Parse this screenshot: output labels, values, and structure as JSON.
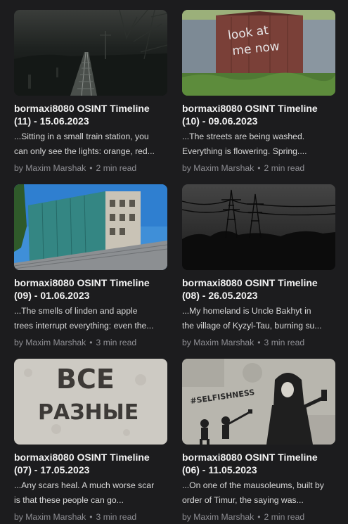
{
  "cards": [
    {
      "title_line1": "bormaxi8080 OSINT Timeline",
      "title_line2": "(11) - 15.06.2023",
      "excerpt_line1": "...Sitting in a small train station, you",
      "excerpt_line2": "can only see the lights: orange, red...",
      "author": "by Maxim Marshak",
      "read_time": "2 min read",
      "image": "railway-night-photo"
    },
    {
      "title_line1": "bormaxi8080 OSINT Timeline",
      "title_line2": "(10) - 09.06.2023",
      "excerpt_line1": "...The streets are being washed.",
      "excerpt_line2": "Everything is flowering. Spring....",
      "author": "by Maxim Marshak",
      "read_time": "2 min read",
      "image": "garage-graffiti-photo",
      "graffiti_line1": "look at",
      "graffiti_line2": "me now"
    },
    {
      "title_line1": "bormaxi8080 OSINT Timeline",
      "title_line2": "(09) - 01.06.2023",
      "excerpt_line1": "...The smells of linden and apple",
      "excerpt_line2": "trees interrupt everything: even the...",
      "author": "by Maxim Marshak",
      "read_time": "3 min read",
      "image": "covered-building-photo"
    },
    {
      "title_line1": "bormaxi8080 OSINT Timeline",
      "title_line2": "(08) - 26.05.2023",
      "excerpt_line1": "...My homeland is Uncle Bakhyt in",
      "excerpt_line2": "the village of Kyzyl-Tau, burning su...",
      "author": "by Maxim Marshak",
      "read_time": "3 min read",
      "image": "power-lines-night-photo"
    },
    {
      "title_line1": "bormaxi8080 OSINT Timeline",
      "title_line2": "(07) - 17.05.2023",
      "excerpt_line1": "...Any scars heal. A much worse scar",
      "excerpt_line2": "is that these people can go...",
      "author": "by Maxim Marshak",
      "read_time": "3 min read",
      "image": "wall-lettering-photo",
      "wall_text_line1": "ВСЕ",
      "wall_text_line2": "РАЗНЫЕ"
    },
    {
      "title_line1": "bormaxi8080 OSINT Timeline",
      "title_line2": "(06) - 11.05.2023",
      "excerpt_line1": "...On one of the mausoleums, built by",
      "excerpt_line2": "order of Timur, the saying was...",
      "author": "by Maxim Marshak",
      "read_time": "2 min read",
      "image": "selfishness-street-art-photo",
      "art_text": "#SELFISHNESS"
    }
  ],
  "meta_separator": "•"
}
